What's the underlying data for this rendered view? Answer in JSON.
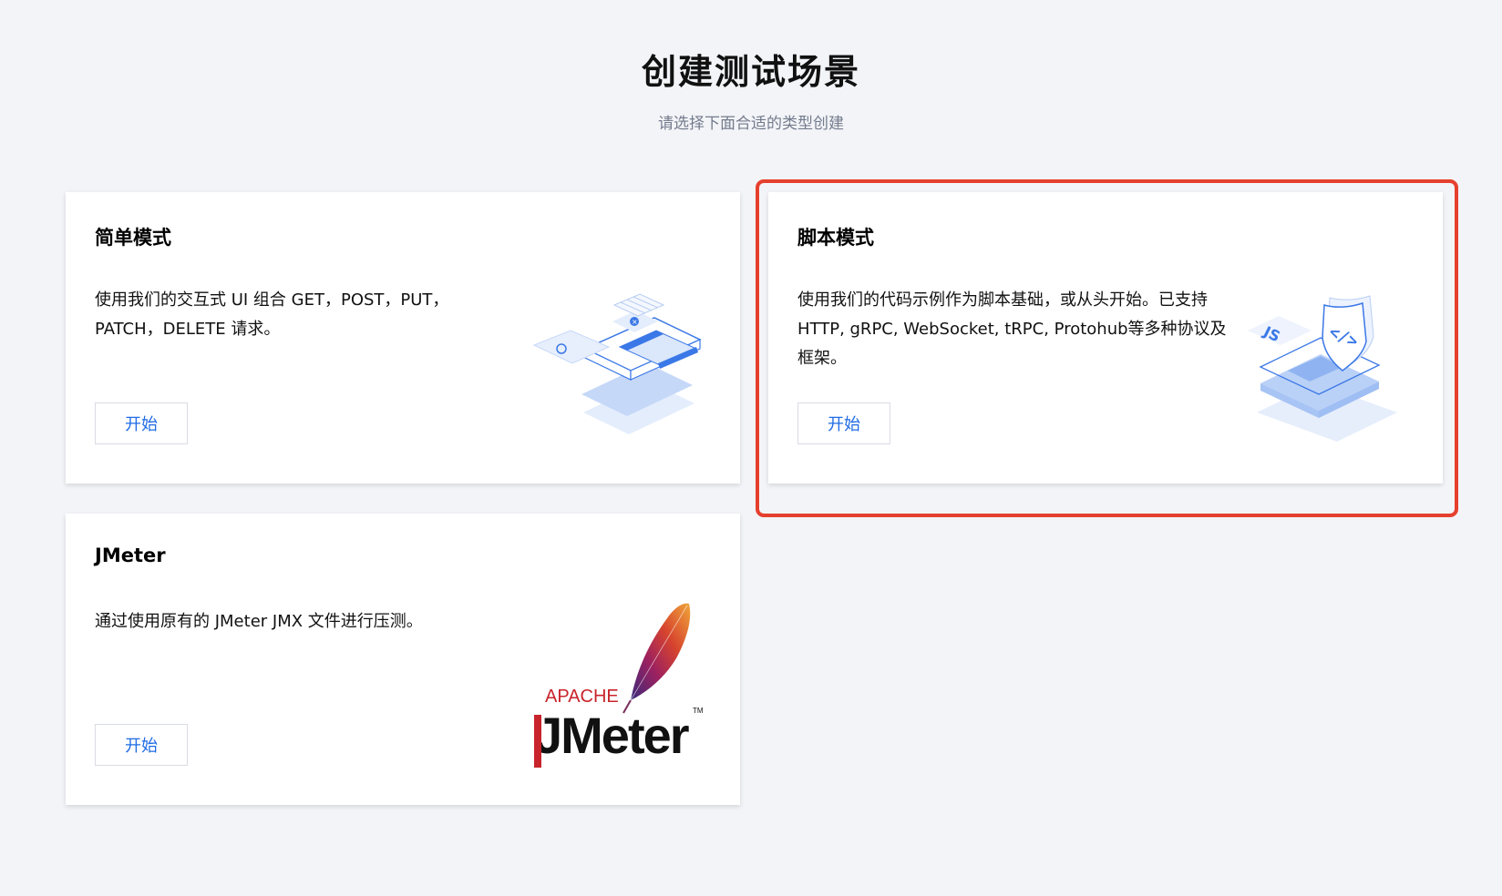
{
  "header": {
    "title": "创建测试场景",
    "subtitle": "请选择下面合适的类型创建"
  },
  "cards": [
    {
      "title": "简单模式",
      "description": "使用我们的交互式 UI 组合 GET，POST，PUT，PATCH，DELETE 请求。",
      "button_label": "开始",
      "illustration": "ui-form-illustration"
    },
    {
      "title": "脚本模式",
      "description": "使用我们的代码示例作为脚本基础，或从头开始。已支持 HTTP, gRPC, WebSocket, tRPC, Protohub等多种协议及框架。",
      "button_label": "开始",
      "illustration": "js-code-illustration",
      "highlighted": true
    },
    {
      "title": "JMeter",
      "description": "通过使用原有的 JMeter JMX 文件进行压测。",
      "button_label": "开始",
      "illustration": "apache-jmeter-logo",
      "logo_text": {
        "apache": "APACHE",
        "jmeter": "JMeter",
        "tm": "TM"
      }
    }
  ],
  "colors": {
    "background": "#f3f4f8",
    "accent": "#1f6be4",
    "highlight": "#e5402e",
    "subtitle": "#737b8c"
  }
}
